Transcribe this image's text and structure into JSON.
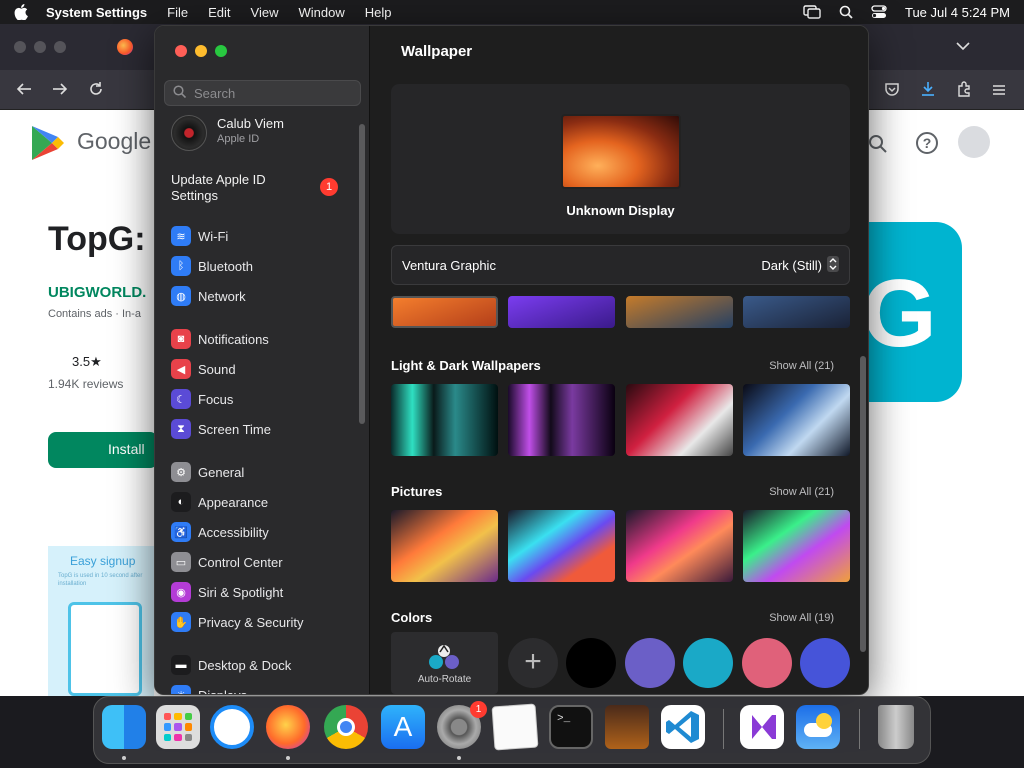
{
  "menubar": {
    "app_name": "System Settings",
    "menus": [
      "File",
      "Edit",
      "View",
      "Window",
      "Help"
    ],
    "clock": "Tue Jul 4  5:24 PM"
  },
  "browser": {
    "google_logo_text": "Google",
    "app_title": "TopG:",
    "developer": "UBIGWORLD.",
    "contains_ads": "Contains ads · In-a",
    "rating": "3.5★",
    "reviews": "1.94K reviews",
    "install_label": "Install",
    "promo_label": "Easy signup",
    "promo_sub": "TopG is used in 10 second after installation",
    "big_letter": "G"
  },
  "sidebar": {
    "search_placeholder": "Search",
    "user_name": "Calub Viem",
    "user_sub": "Apple ID",
    "update_label": "Update Apple ID Settings",
    "update_badge": "1",
    "items": [
      {
        "label": "Wi-Fi",
        "icon": "wifi-icon",
        "color": "#2f7cf6"
      },
      {
        "label": "Bluetooth",
        "icon": "bluetooth-icon",
        "color": "#2f7cf6"
      },
      {
        "label": "Network",
        "icon": "globe-icon",
        "color": "#2f7cf6"
      },
      {
        "label": "Notifications",
        "icon": "bell-icon",
        "color": "#e8424a"
      },
      {
        "label": "Sound",
        "icon": "speaker-icon",
        "color": "#e8424a"
      },
      {
        "label": "Focus",
        "icon": "moon-icon",
        "color": "#5b4bd6"
      },
      {
        "label": "Screen Time",
        "icon": "hourglass-icon",
        "color": "#5b4bd6"
      },
      {
        "label": "General",
        "icon": "gear-icon",
        "color": "#8e8e93"
      },
      {
        "label": "Appearance",
        "icon": "appearance-icon",
        "color": "#1c1c1e"
      },
      {
        "label": "Accessibility",
        "icon": "accessibility-icon",
        "color": "#2f7cf6"
      },
      {
        "label": "Control Center",
        "icon": "control-center-icon",
        "color": "#8e8e93"
      },
      {
        "label": "Siri & Spotlight",
        "icon": "siri-icon",
        "color": "#b43cd6"
      },
      {
        "label": "Privacy & Security",
        "icon": "hand-icon",
        "color": "#2f7cf6"
      },
      {
        "label": "Desktop & Dock",
        "icon": "dock-icon",
        "color": "#1c1c1e"
      },
      {
        "label": "Displays",
        "icon": "sun-icon",
        "color": "#2f7cf6"
      }
    ]
  },
  "main": {
    "title": "Wallpaper",
    "display_name": "Unknown Display",
    "wallpaper_name": "Ventura Graphic",
    "wallpaper_mode": "Dark (Still)",
    "sections": [
      {
        "title": "Light & Dark Wallpapers",
        "show_all": "Show All (21)"
      },
      {
        "title": "Pictures",
        "show_all": "Show All (21)"
      },
      {
        "title": "Colors",
        "show_all": "Show All (19)"
      }
    ],
    "auto_rotate_label": "Auto-Rotate",
    "color_swatches": [
      "#000000",
      "#6b5fc7",
      "#1aa9c7",
      "#e0617a",
      "#4654d9"
    ]
  },
  "dock": {
    "apps": [
      "Finder",
      "Launchpad",
      "Safari",
      "Firefox",
      "Chrome",
      "App Store",
      "System Settings",
      "TextEdit",
      "Terminal",
      "GarageBand",
      "VS Code",
      "Visual Studio",
      "Weather",
      "Trash"
    ],
    "settings_badge": "1"
  }
}
